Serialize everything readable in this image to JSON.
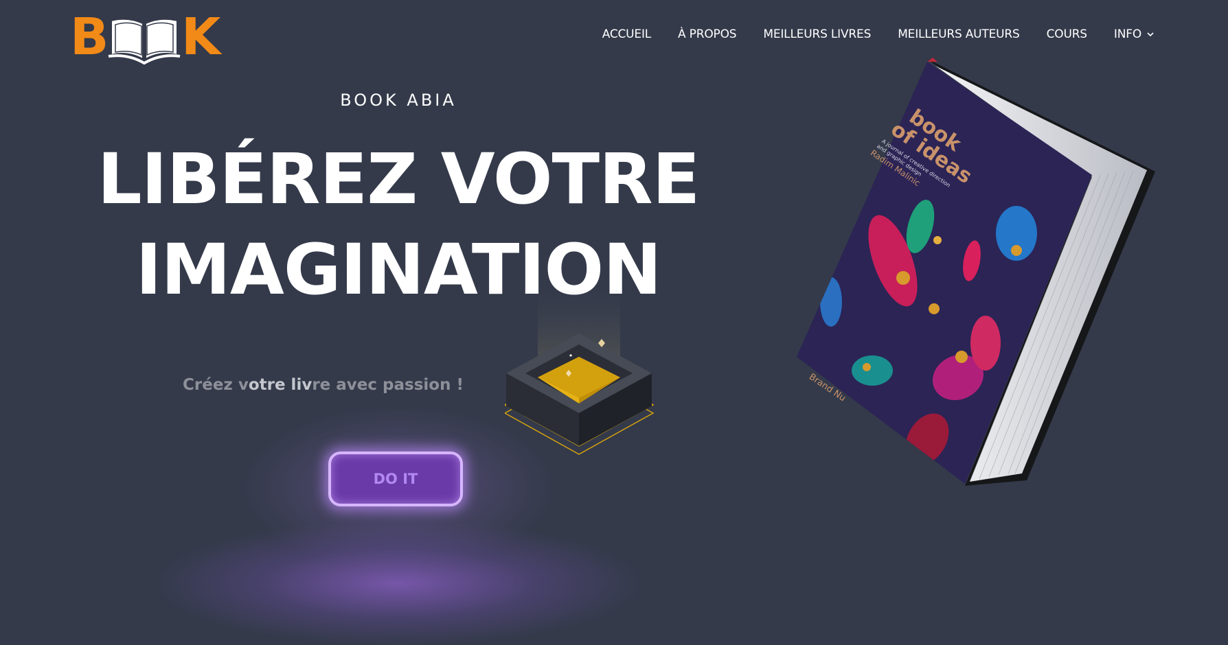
{
  "logo": {
    "letter_left": "B",
    "letter_right": "K",
    "icon": "open-book-icon",
    "brand_color": "#f28a17"
  },
  "nav": {
    "items": [
      {
        "label": "ACCUEIL"
      },
      {
        "label": "À PROPOS"
      },
      {
        "label": "MEILLEURS LIVRES"
      },
      {
        "label": "MEILLEURS AUTEURS"
      },
      {
        "label": "COURS"
      },
      {
        "label": "INFO",
        "icon": "chevron-down-icon"
      }
    ]
  },
  "hero": {
    "eyebrow": "BOOK ABIA",
    "headline_line1": "LIBÉREZ VOTRE",
    "headline_line2": "IMAGINATION",
    "tagline_part1": "Créez v",
    "tagline_part2": "otre liv",
    "tagline_part3": "re avec passion !",
    "cta_label": "DO IT"
  },
  "book_cover": {
    "title_line1": "book",
    "title_line2": "of ideas",
    "subtitle_line1": "A journal of creative direction",
    "subtitle_line2": "and graphic design",
    "author": "Radim Malinic",
    "publisher": "Brand Nu"
  },
  "colors": {
    "background": "#343a4a",
    "accent_orange": "#f28a17",
    "cta_purple": "#6a3aa8",
    "cta_glow": "#d7b6ff",
    "pyramid_gold": "#d4a10e"
  }
}
